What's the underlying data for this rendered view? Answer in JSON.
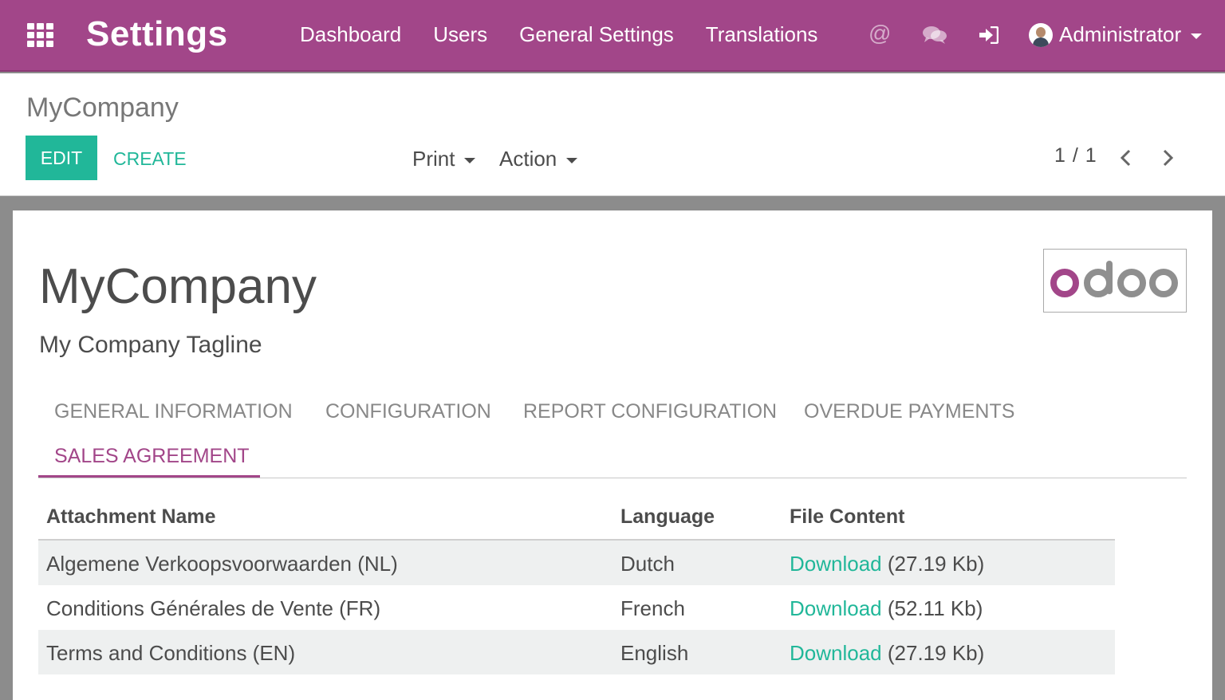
{
  "navbar": {
    "app_title": "Settings",
    "menu": [
      "Dashboard",
      "Users",
      "General Settings",
      "Translations"
    ],
    "icons": [
      "apps-grid-icon",
      "at-mention-icon",
      "chat-bubbles-icon",
      "sign-in-icon"
    ],
    "user_name": "Administrator",
    "color": "#a24689"
  },
  "control_panel": {
    "breadcrumb": "MyCompany",
    "edit_label": "EDIT",
    "create_label": "CREATE",
    "print_label": "Print",
    "action_label": "Action",
    "pager": "1 / 1"
  },
  "form": {
    "name": "MyCompany",
    "tagline": "My Company Tagline",
    "logo_text": "odoo",
    "tabs": [
      "GENERAL INFORMATION",
      "CONFIGURATION",
      "REPORT CONFIGURATION",
      "OVERDUE PAYMENTS",
      "SALES AGREEMENT"
    ],
    "active_tab": "SALES AGREEMENT",
    "table": {
      "headers": [
        "Attachment Name",
        "Language",
        "File Content"
      ],
      "rows": [
        {
          "name": "Algemene Verkoopsvoorwaarden (NL)",
          "language": "Dutch",
          "link": "Download",
          "size": "(27.19 Kb)"
        },
        {
          "name": "Conditions Générales de Vente (FR)",
          "language": "French",
          "link": "Download",
          "size": "(52.11 Kb)"
        },
        {
          "name": "Terms and Conditions (EN)",
          "language": "English",
          "link": "Download",
          "size": "(27.19 Kb)"
        }
      ]
    }
  },
  "colors": {
    "accent": "#21b799",
    "brand": "#a24689"
  }
}
